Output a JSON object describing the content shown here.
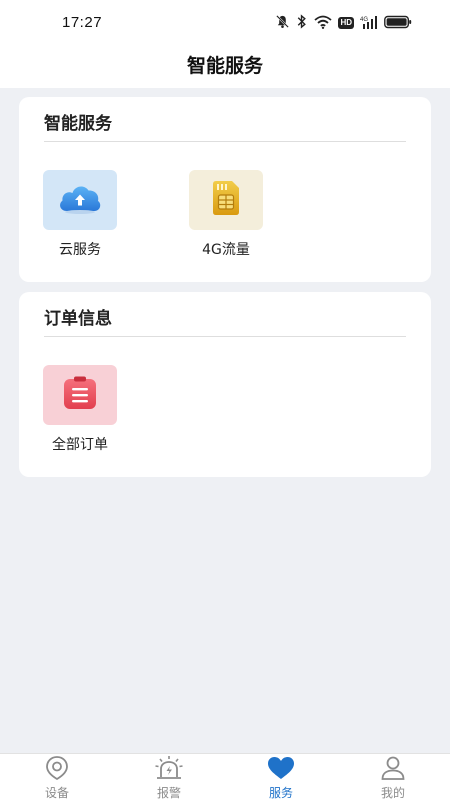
{
  "status_bar": {
    "time": "17:27",
    "icons": [
      "bell-muted-icon",
      "bluetooth-icon",
      "wifi-icon",
      "hd-icon",
      "signal-4g-icon",
      "battery-icon"
    ],
    "hd_label": "HD"
  },
  "header": {
    "title": "智能服务"
  },
  "sections": [
    {
      "title": "智能服务",
      "items": [
        {
          "label": "云服务",
          "icon": "cloud-upload-icon",
          "bg": "#d3e6f7"
        },
        {
          "label": "4G流量",
          "icon": "sim-card-icon",
          "bg": "#f4eedb"
        }
      ]
    },
    {
      "title": "订单信息",
      "items": [
        {
          "label": "全部订单",
          "icon": "order-clipboard-icon",
          "bg": "#f8d0d6"
        }
      ]
    }
  ],
  "tabbar": {
    "active_color": "#1f72c9",
    "inactive_color": "#8b8b8b",
    "tabs": [
      {
        "label": "设备",
        "icon": "device-eye-icon",
        "active": false
      },
      {
        "label": "报警",
        "icon": "alarm-siren-icon",
        "active": false
      },
      {
        "label": "服务",
        "icon": "heart-icon",
        "active": true
      },
      {
        "label": "我的",
        "icon": "user-icon",
        "active": false
      }
    ]
  }
}
